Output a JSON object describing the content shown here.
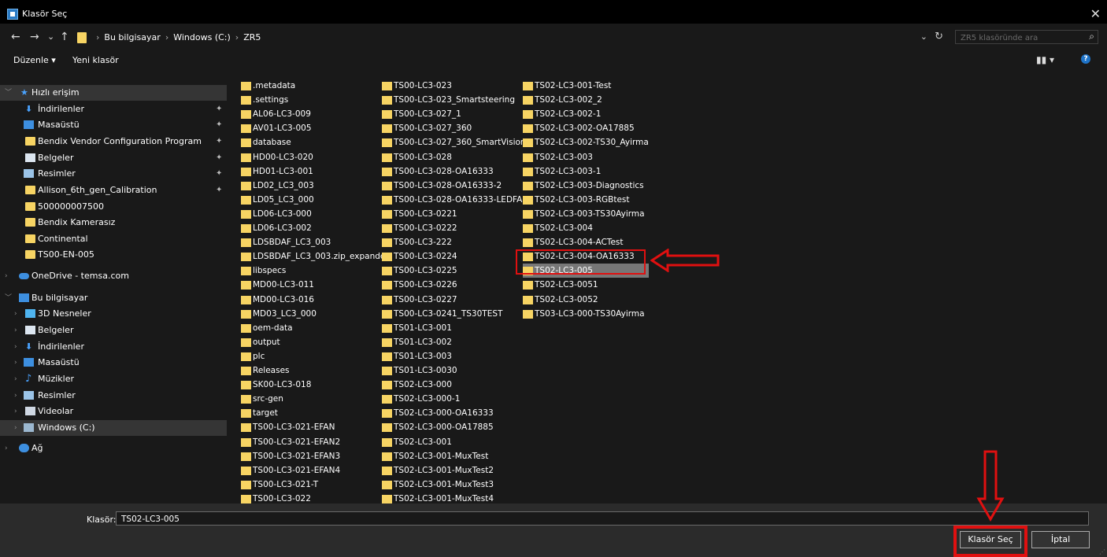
{
  "window": {
    "title": "Klasör Seç",
    "close": "✕"
  },
  "nav": {
    "back": "←",
    "forward": "→",
    "recent": "⌄",
    "up": "↑"
  },
  "address": {
    "crumbs": [
      "Bu bilgisayar",
      "Windows (C:)",
      "ZR5"
    ],
    "dropdown": "⌄",
    "refresh": "↻"
  },
  "search": {
    "placeholder": "ZR5 klasöründe ara",
    "icon": "⌕"
  },
  "toolbar": {
    "organize": "Düzenle ▾",
    "new_folder": "Yeni klasör",
    "view": "▮▮ ▾",
    "help": "?"
  },
  "sidebar": {
    "quick_access": {
      "label": "Hızlı erişim",
      "items": [
        {
          "label": "İndirilenler",
          "icon": "download-icon",
          "pinned": true
        },
        {
          "label": "Masaüstü",
          "icon": "desktop-icon",
          "pinned": true
        },
        {
          "label": "Bendix Vendor Configuration Program",
          "icon": "folder-icon",
          "pinned": true
        },
        {
          "label": "Belgeler",
          "icon": "documents-icon",
          "pinned": true
        },
        {
          "label": "Resimler",
          "icon": "pictures-icon",
          "pinned": true
        },
        {
          "label": "Allison_6th_gen_Calibration",
          "icon": "folder-icon",
          "pinned": true
        },
        {
          "label": "500000007500",
          "icon": "folder-icon",
          "pinned": false
        },
        {
          "label": "Bendix Kamerasız",
          "icon": "folder-icon",
          "pinned": false
        },
        {
          "label": "Continental",
          "icon": "folder-icon",
          "pinned": false
        },
        {
          "label": "TS00-EN-005",
          "icon": "folder-icon",
          "pinned": false
        }
      ]
    },
    "onedrive": "OneDrive - temsa.com",
    "this_pc": {
      "label": "Bu bilgisayar",
      "items": [
        {
          "label": "3D Nesneler",
          "icon": "3d-objects-icon"
        },
        {
          "label": "Belgeler",
          "icon": "documents-icon"
        },
        {
          "label": "İndirilenler",
          "icon": "download-icon"
        },
        {
          "label": "Masaüstü",
          "icon": "desktop-icon"
        },
        {
          "label": "Müzikler",
          "icon": "music-icon"
        },
        {
          "label": "Resimler",
          "icon": "pictures-icon"
        },
        {
          "label": "Videolar",
          "icon": "videos-icon"
        },
        {
          "label": "Windows (C:)",
          "icon": "drive-icon"
        }
      ]
    },
    "network": "Ağ",
    "pin_glyph": "📌"
  },
  "files": {
    "columns": [
      [
        ".metadata",
        ".settings",
        "AL06-LC3-009",
        "AV01-LC3-005",
        "database",
        "HD00-LC3-020",
        "HD01-LC3-001",
        "LD02_LC3_003",
        "LD05_LC3_000",
        "LD06-LC3-000",
        "LD06-LC3-002",
        "LDSBDAF_LC3_003",
        "LDSBDAF_LC3_003.zip_expanded",
        "libspecs",
        "MD00-LC3-011",
        "MD00-LC3-016",
        "MD03_LC3_000",
        "oem-data",
        "output",
        "plc",
        "Releases",
        "SK00-LC3-018",
        "src-gen",
        "target",
        "TS00-LC3-021-EFAN",
        "TS00-LC3-021-EFAN2",
        "TS00-LC3-021-EFAN3",
        "TS00-LC3-021-EFAN4",
        "TS00-LC3-021-T",
        "TS00-LC3-022"
      ],
      [
        "TS00-LC3-023",
        "TS00-LC3-023_Smartsteering",
        "TS00-LC3-027_1",
        "TS00-LC3-027_360",
        "TS00-LC3-027_360_SmartVision",
        "TS00-LC3-028",
        "TS00-LC3-028-OA16333",
        "TS00-LC3-028-OA16333-2",
        "TS00-LC3-028-OA16333-LEDFAR",
        "TS00-LC3-0221",
        "TS00-LC3-0222",
        "TS00-LC3-222",
        "TS00-LC3-0224",
        "TS00-LC3-0225",
        "TS00-LC3-0226",
        "TS00-LC3-0227",
        "TS00-LC3-0241_TS30TEST",
        "TS01-LC3-001",
        "TS01-LC3-002",
        "TS01-LC3-003",
        "TS01-LC3-0030",
        "TS02-LC3-000",
        "TS02-LC3-000-1",
        "TS02-LC3-000-OA16333",
        "TS02-LC3-000-OA17885",
        "TS02-LC3-001",
        "TS02-LC3-001-MuxTest",
        "TS02-LC3-001-MuxTest2",
        "TS02-LC3-001-MuxTest3",
        "TS02-LC3-001-MuxTest4"
      ],
      [
        "TS02-LC3-001-Test",
        "TS02-LC3-002_2",
        "TS02-LC3-002-1",
        "TS02-LC3-002-OA17885",
        "TS02-LC3-002-TS30_Ayirma",
        "TS02-LC3-003",
        "TS02-LC3-003-1",
        "TS02-LC3-003-Diagnostics",
        "TS02-LC3-003-RGBtest",
        "TS02-LC3-003-TS30Ayirma",
        "TS02-LC3-004",
        "TS02-LC3-004-ACTest",
        "TS02-LC3-004-OA16333",
        "TS02-LC3-005",
        "TS02-LC3-0051",
        "TS02-LC3-0052",
        "TS03-LC3-000-TS30Ayirma"
      ]
    ],
    "selected": "TS02-LC3-005"
  },
  "footer": {
    "folder_label": "Klasör:",
    "folder_value": "TS02-LC3-005",
    "select_button": "Klasör Seç",
    "cancel_button": "İptal"
  },
  "colors": {
    "folder": "#f7d463",
    "annotation": "#e01010",
    "selection": "#777777",
    "background": "#191919"
  }
}
